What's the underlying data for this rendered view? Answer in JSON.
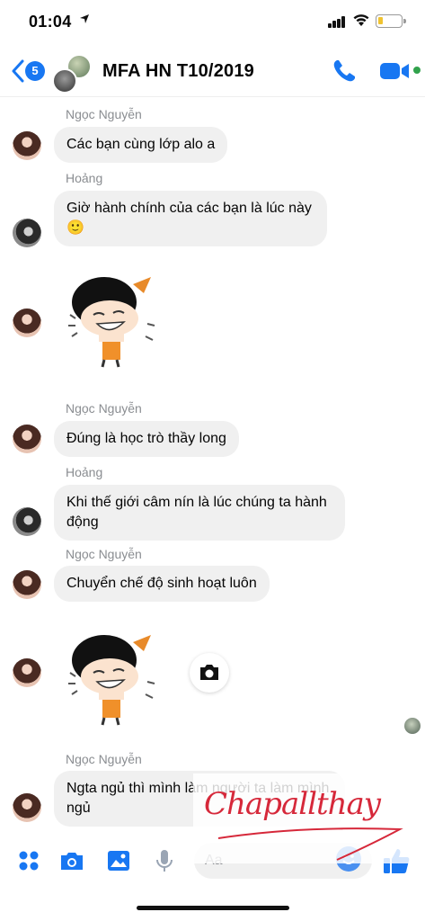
{
  "status_bar": {
    "time": "01:04",
    "battery_level": 0.2,
    "icons": [
      "location-arrow-icon",
      "signal-icon",
      "wifi-icon",
      "battery-icon"
    ]
  },
  "header": {
    "back_badge_count": "5",
    "title": "MFA HN T10/2019",
    "accent_color": "#1877f2",
    "online_color": "#31a24c",
    "icons": [
      "back-chevron-icon",
      "phone-icon",
      "video-camera-icon"
    ]
  },
  "messages": [
    {
      "sender": "Ngọc Nguyễn",
      "text": "Các bạn cùng lớp alo a"
    },
    {
      "sender": "Hoảng",
      "text": "Giờ hành chính của các bạn là lúc này",
      "emoji": "🙂"
    },
    {
      "sender": "",
      "sticker": "crying-girl-sticker"
    },
    {
      "sender": "Ngọc Nguyễn",
      "text": "Đúng là học trò thầy long"
    },
    {
      "sender": "Hoảng",
      "line1": "Khi thế giới câm nín là lúc chúng ta hành",
      "line2": "động"
    },
    {
      "sender": "Ngọc Nguyễn",
      "text": "Chuyển chế độ sinh hoạt luôn"
    },
    {
      "sender": "",
      "sticker": "crying-girl-sticker"
    },
    {
      "sender": "Ngọc Nguyễn",
      "line1": "Ngta ngủ thì mình làm người ta làm mình",
      "line2": "ngủ"
    }
  ],
  "watermark": {
    "signature_text": "Chapallthay",
    "color": "#d6283a"
  },
  "composer": {
    "placeholder": "Aa",
    "tools": [
      "apps-grid-icon",
      "camera-icon",
      "gallery-icon",
      "microphone-icon"
    ],
    "right_icons": [
      "emoji-icon",
      "thumbs-up-icon"
    ]
  }
}
